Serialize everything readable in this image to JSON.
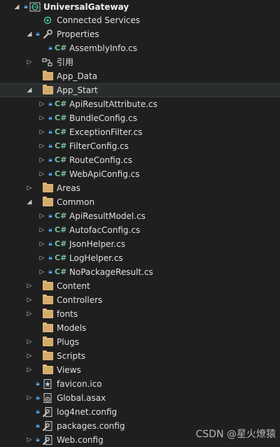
{
  "project": "UniversalGateway",
  "items": {
    "connected_services": "Connected Services",
    "properties": "Properties",
    "assembly_info": "AssemblyInfo.cs",
    "references": "引用",
    "app_data": "App_Data",
    "app_start": "App_Start",
    "api_result_attribute": "ApiResultAttribute.cs",
    "bundle_config": "BundleConfig.cs",
    "exception_filter": "ExceptionFilter.cs",
    "filter_config": "FilterConfig.cs",
    "route_config": "RouteConfig.cs",
    "webapi_config": "WebApiConfig.cs",
    "areas": "Areas",
    "common": "Common",
    "api_result_model": "ApiResultModel.cs",
    "autofac_config": "AutofacConfig.cs",
    "json_helper": "JsonHelper.cs",
    "log_helper": "LogHelper.cs",
    "no_package_result": "NoPackageResult.cs",
    "content": "Content",
    "controllers": "Controllers",
    "fonts": "fonts",
    "models": "Models",
    "plugs": "Plugs",
    "scripts": "Scripts",
    "views": "Views",
    "favicon": "favicon.ico",
    "global_asax": "Global.asax",
    "log4net": "log4net.config",
    "packages": "packages.config",
    "web_config": "Web.config"
  },
  "cs_tag": "C#",
  "watermark": "CSDN @星火燎猿",
  "colors": {
    "background": "#1f1f1f",
    "folder": "#dcb67a",
    "csharp": "#79c0a5",
    "lock": "#4f9fe6"
  }
}
